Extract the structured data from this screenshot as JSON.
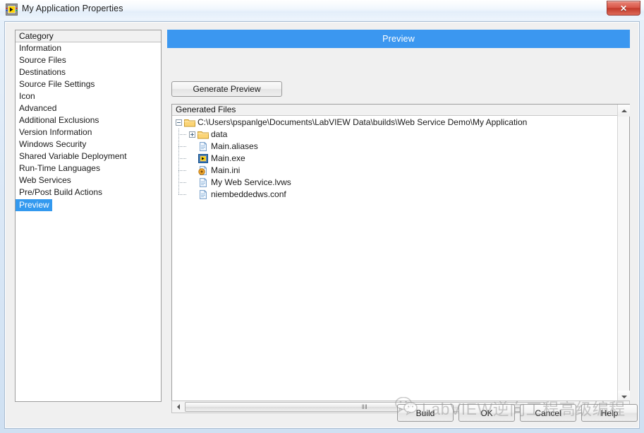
{
  "window": {
    "title": "My Application Properties",
    "title_icon": "labview-vi-icon",
    "close_label": "✕"
  },
  "category": {
    "header": "Category",
    "items": [
      {
        "label": "Information",
        "selected": false
      },
      {
        "label": "Source Files",
        "selected": false
      },
      {
        "label": "Destinations",
        "selected": false
      },
      {
        "label": "Source File Settings",
        "selected": false
      },
      {
        "label": "Icon",
        "selected": false
      },
      {
        "label": "Advanced",
        "selected": false
      },
      {
        "label": "Additional Exclusions",
        "selected": false
      },
      {
        "label": "Version Information",
        "selected": false
      },
      {
        "label": "Windows Security",
        "selected": false
      },
      {
        "label": "Shared Variable Deployment",
        "selected": false
      },
      {
        "label": "Run-Time Languages",
        "selected": false
      },
      {
        "label": "Web Services",
        "selected": false
      },
      {
        "label": "Pre/Post Build Actions",
        "selected": false
      },
      {
        "label": "Preview",
        "selected": true
      }
    ]
  },
  "main": {
    "banner_title": "Preview",
    "generate_button": "Generate Preview",
    "files_header": "Generated Files",
    "tree": [
      {
        "label": "C:\\Users\\pspanlge\\Documents\\LabVIEW Data\\builds\\Web Service Demo\\My Application",
        "icon": "folder-open-icon",
        "expander": "minus",
        "depth": 0
      },
      {
        "label": "data",
        "icon": "folder-icon",
        "expander": "plus",
        "depth": 1
      },
      {
        "label": "Main.aliases",
        "icon": "file-icon",
        "expander": "none",
        "depth": 1
      },
      {
        "label": "Main.exe",
        "icon": "labview-exe-icon",
        "expander": "none",
        "depth": 1
      },
      {
        "label": "Main.ini",
        "icon": "ini-file-icon",
        "expander": "none",
        "depth": 1
      },
      {
        "label": "My Web Service.lvws",
        "icon": "file-icon",
        "expander": "none",
        "depth": 1
      },
      {
        "label": "niembeddedws.conf",
        "icon": "file-icon",
        "expander": "none",
        "depth": 1
      }
    ],
    "h_scroll_grip": "‖‖"
  },
  "footer": {
    "buttons": [
      {
        "label": "Build"
      },
      {
        "label": "OK"
      },
      {
        "label": "Cancel"
      },
      {
        "label": "Help"
      }
    ]
  },
  "watermark": {
    "text": "LabVIEW逆向工程高级编程",
    "logo": "wechat-logo-icon"
  },
  "colors": {
    "accent_blue": "#3b97f0",
    "selection_blue": "#3399ef",
    "close_red": "#c33a2b",
    "folder_yellow": "#f5c451"
  }
}
